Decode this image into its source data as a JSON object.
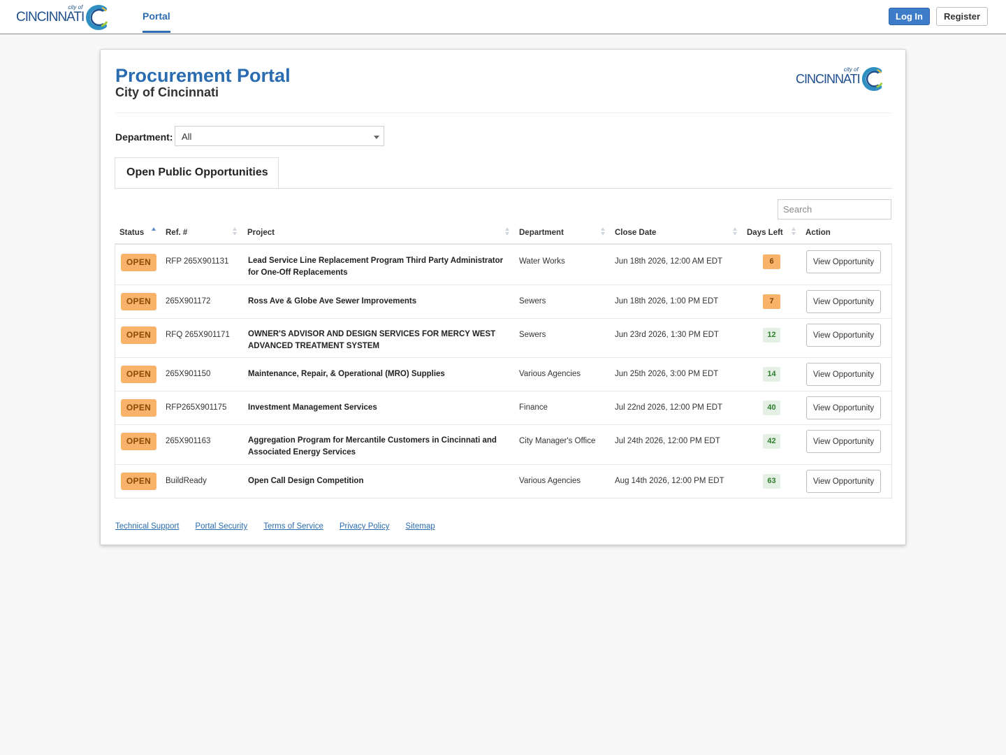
{
  "header": {
    "logo_word": "CINCINNATI",
    "logo_cityof": "city of",
    "nav_portal": "Portal",
    "login_label": "Log In",
    "register_label": "Register"
  },
  "page": {
    "title": "Procurement Portal",
    "subtitle": "City of Cincinnati"
  },
  "filters": {
    "department_label": "Department:",
    "department_value": "All",
    "search_placeholder": "Search"
  },
  "tab_label": "Open Public Opportunities",
  "table": {
    "columns": [
      "Status",
      "Ref. #",
      "Project",
      "Department",
      "Close Date",
      "Days Left",
      "Action"
    ],
    "rows": [
      {
        "status": "OPEN",
        "ref": "RFP 265X901131",
        "project": "Lead Service Line Replacement Program Third Party Administrator for One-Off Replacements",
        "department": "Water Works",
        "close_date": "Jun 18th 2026, 12:00 AM EDT",
        "days_left": "6",
        "action": "View Opportunity"
      },
      {
        "status": "OPEN",
        "ref": "265X901172",
        "project": "Ross Ave & Globe Ave Sewer Improvements",
        "department": "Sewers",
        "close_date": "Jun 18th 2026, 1:00 PM EDT",
        "days_left": "7",
        "action": "View Opportunity"
      },
      {
        "status": "OPEN",
        "ref": "RFQ 265X901171",
        "project": "OWNER'S ADVISOR AND DESIGN SERVICES FOR MERCY WEST ADVANCED TREATMENT SYSTEM",
        "department": "Sewers",
        "close_date": "Jun 23rd 2026, 1:30 PM EDT",
        "days_left": "12",
        "action": "View Opportunity"
      },
      {
        "status": "OPEN",
        "ref": "265X901150",
        "project": "Maintenance, Repair, & Operational (MRO) Supplies",
        "department": "Various Agencies",
        "close_date": "Jun 25th 2026, 3:00 PM EDT",
        "days_left": "14",
        "action": "View Opportunity"
      },
      {
        "status": "OPEN",
        "ref": "RFP265X901175",
        "project": "Investment Management Services",
        "department": "Finance",
        "close_date": "Jul 22nd 2026, 12:00 PM EDT",
        "days_left": "40",
        "action": "View Opportunity"
      },
      {
        "status": "OPEN",
        "ref": "265X901163",
        "project": "Aggregation Program for Mercantile Customers in Cincinnati and Associated Energy Services",
        "department": "City Manager's Office",
        "close_date": "Jul 24th 2026, 12:00 PM EDT",
        "days_left": "42",
        "action": "View Opportunity"
      },
      {
        "status": "OPEN",
        "ref": "BuildReady",
        "project": "Open Call Design Competition",
        "department": "Various Agencies",
        "close_date": "Aug 14th 2026, 12:00 PM EDT",
        "days_left": "63",
        "action": "View Opportunity"
      }
    ]
  },
  "footer": {
    "links": [
      "Technical Support",
      "Portal Security",
      "Terms of Service",
      "Privacy Policy",
      "Sitemap"
    ]
  },
  "colors": {
    "brand_blue": "#2b6cb0",
    "open_badge": "#f8b26a",
    "days_urgent": "#f8b26a",
    "days_ok": "#e3f0e3"
  }
}
